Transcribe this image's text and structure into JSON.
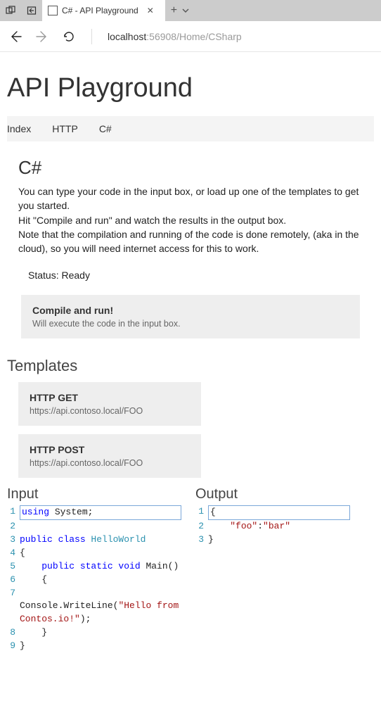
{
  "browser": {
    "tab_title": "C# - API Playground",
    "address_host": "localhost",
    "address_path": ":56908/Home/CSharp"
  },
  "page": {
    "title": "API Playground",
    "tabs": [
      "Index",
      "HTTP",
      "C#"
    ],
    "heading": "C#",
    "description_line1": "You can type your code in the input box, or load up one of the templates to get you started.",
    "description_line2": "Hit \"Compile and run\" and watch the results in the output box.",
    "description_line3": "Note that the compilation and running of the code is done remotely, (aka in the cloud), so you will need internet access for this to work.",
    "status": "Status: Ready",
    "compile_title": "Compile and run!",
    "compile_sub": "Will execute the code in the input box.",
    "templates_heading": "Templates",
    "templates": [
      {
        "title": "HTTP GET",
        "url": "https://api.contoso.local/FOO"
      },
      {
        "title": "HTTP POST",
        "url": "https://api.contoso.local/FOO"
      }
    ],
    "input_heading": "Input",
    "output_heading": "Output",
    "input_code": {
      "lines": [
        {
          "n": 1,
          "tokens": [
            {
              "t": "using ",
              "c": "kw"
            },
            {
              "t": "System;",
              "c": ""
            }
          ]
        },
        {
          "n": 2,
          "tokens": [
            {
              "t": "",
              "c": ""
            }
          ]
        },
        {
          "n": 3,
          "tokens": [
            {
              "t": "public class ",
              "c": "kw"
            },
            {
              "t": "HelloWorld",
              "c": "cls"
            }
          ]
        },
        {
          "n": 4,
          "tokens": [
            {
              "t": "{",
              "c": ""
            }
          ]
        },
        {
          "n": 5,
          "tokens": [
            {
              "t": "    ",
              "c": ""
            },
            {
              "t": "public static void",
              "c": "kw"
            },
            {
              "t": " Main()",
              "c": ""
            }
          ]
        },
        {
          "n": 6,
          "tokens": [
            {
              "t": "    {",
              "c": ""
            }
          ]
        },
        {
          "n": 7,
          "tokens": [
            {
              "t": "        Console.WriteLine(",
              "c": ""
            },
            {
              "t": "\"Hello from Contos.io!\"",
              "c": "str"
            },
            {
              "t": ");",
              "c": ""
            }
          ]
        },
        {
          "n": 8,
          "tokens": [
            {
              "t": "    }",
              "c": ""
            }
          ]
        },
        {
          "n": 9,
          "tokens": [
            {
              "t": "}",
              "c": ""
            }
          ]
        }
      ]
    },
    "output_code": {
      "lines": [
        {
          "n": 1,
          "tokens": [
            {
              "t": "{",
              "c": ""
            }
          ]
        },
        {
          "n": 2,
          "tokens": [
            {
              "t": "    ",
              "c": ""
            },
            {
              "t": "\"foo\"",
              "c": "str"
            },
            {
              "t": ":",
              "c": ""
            },
            {
              "t": "\"bar\"",
              "c": "str"
            }
          ]
        },
        {
          "n": 3,
          "tokens": [
            {
              "t": "}",
              "c": ""
            }
          ]
        }
      ]
    }
  }
}
